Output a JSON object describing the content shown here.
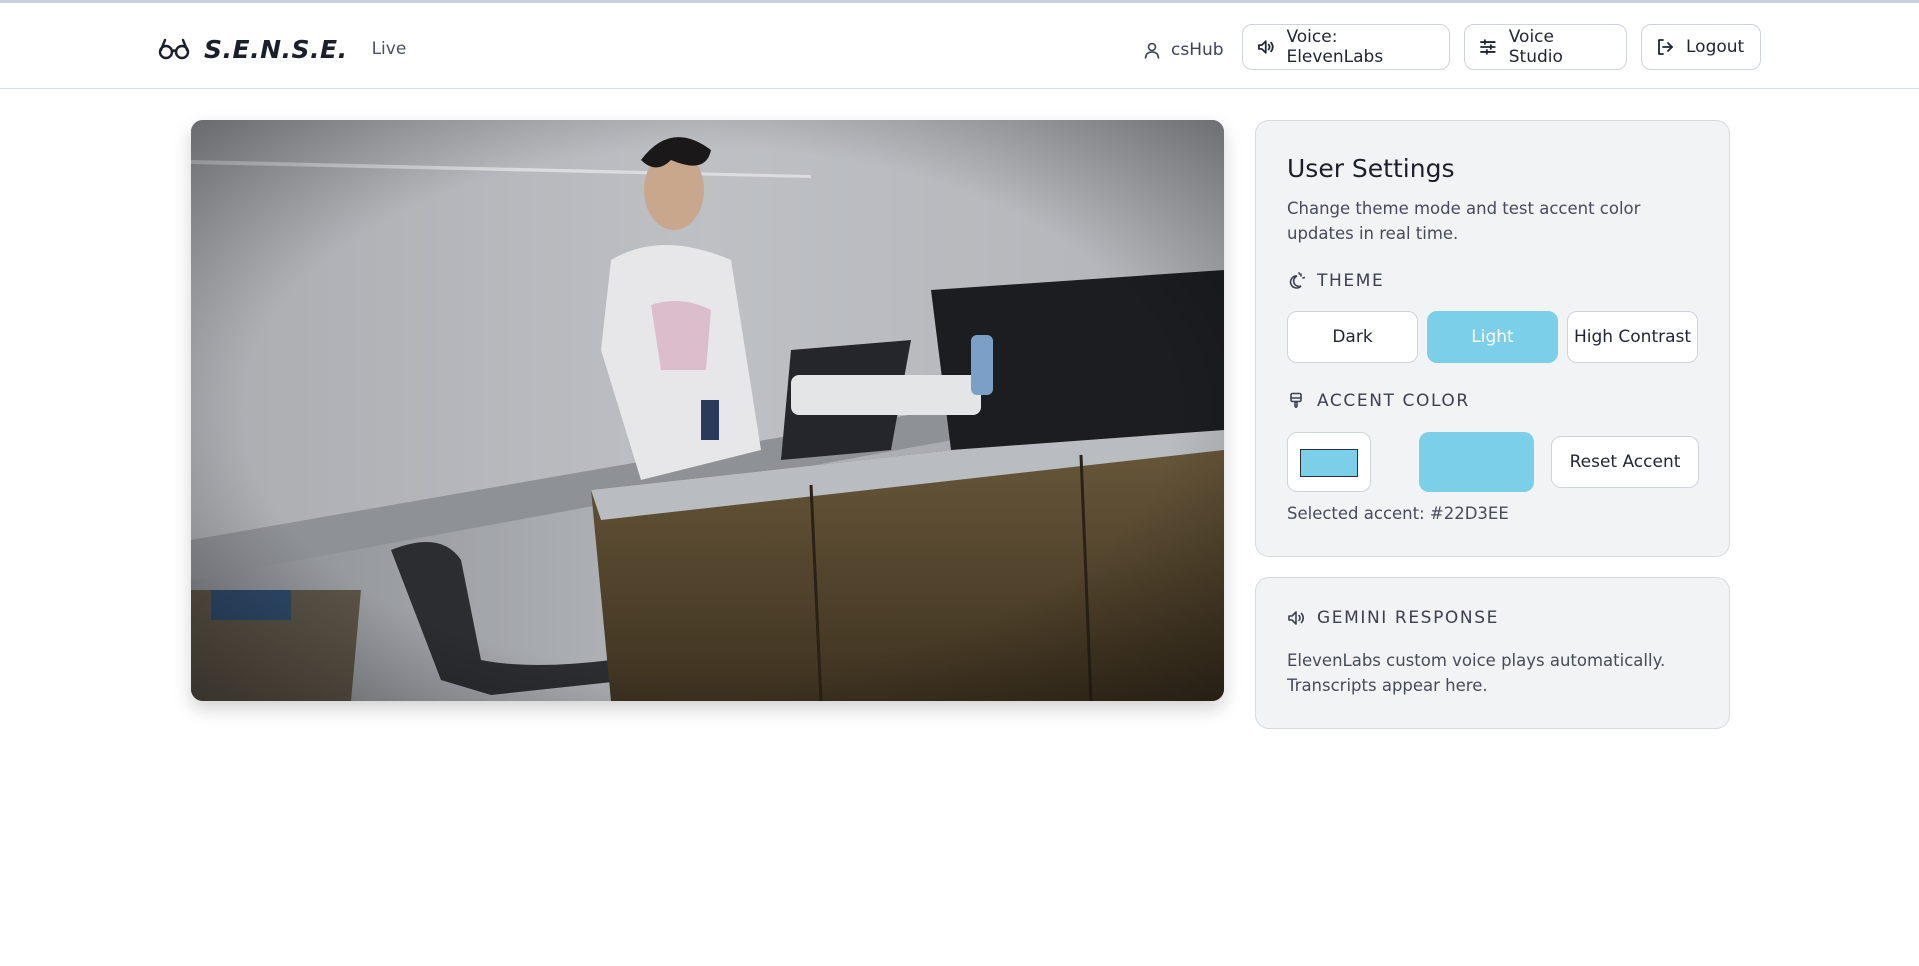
{
  "header": {
    "brand": "S.E.N.S.E.",
    "status": "Live",
    "user": "csHub",
    "buttons": {
      "voice": "Voice: ElevenLabs",
      "studio": "Voice Studio",
      "logout": "Logout"
    }
  },
  "settings": {
    "title": "User Settings",
    "description": "Change theme mode and test accent color updates in real time.",
    "theme_label": "THEME",
    "theme_options": [
      "Dark",
      "Light",
      "High Contrast"
    ],
    "selected_theme": "Light",
    "accent_label": "ACCENT COLOR",
    "reset_label": "Reset Accent",
    "selected_accent_text": "Selected accent: #22D3EE",
    "accent_color": "#7ccfe8"
  },
  "gemini": {
    "label": "GEMINI RESPONSE",
    "text": "ElevenLabs custom voice plays automatically. Transcripts appear here."
  },
  "icons": {
    "brand": "glasses-icon",
    "user": "user-icon",
    "voice": "speaker-icon",
    "studio": "sliders-icon",
    "logout": "logout-icon",
    "theme": "theme-icon",
    "accent": "paintbrush-icon",
    "gemini": "speaker-icon"
  }
}
